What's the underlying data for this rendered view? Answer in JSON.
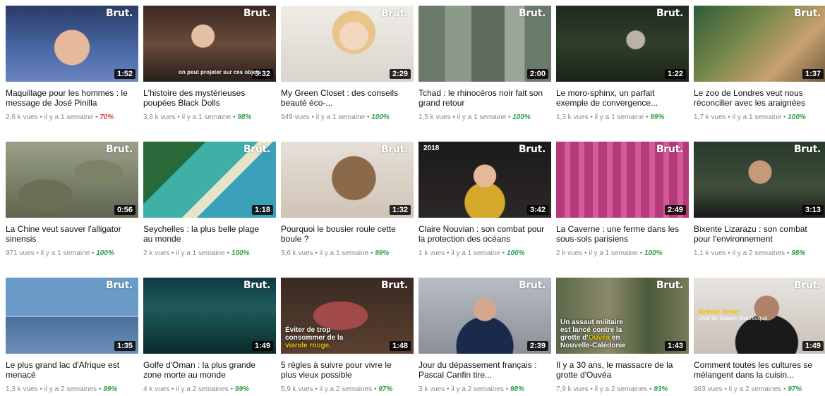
{
  "videos": [
    {
      "title": "Maquillage pour les hommes : le message de José Pinilla",
      "duration": "1:52",
      "views": "2,6 k vues",
      "age": "il y a 1 semaine",
      "rating": "70%",
      "brand": "Brut.",
      "thumb_icon": "man-talking-thumbnail"
    },
    {
      "title": "L'histoire des mystérieuses poupées Black Dolls",
      "duration": "3:32",
      "views": "3,6 k vues",
      "age": "il y a 1 semaine",
      "rating": "98%",
      "brand": "Brut.",
      "thumb_icon": "woman-in-gallery-thumbnail",
      "caption": "on peut projeter sur ces objets"
    },
    {
      "title": "My Green Closet : des conseils beauté éco-...",
      "duration": "2:29",
      "views": "949 vues",
      "age": "il y a 1 semaine",
      "rating": "100%",
      "brand": "Brut.",
      "thumb_icon": "blonde-woman-thumbnail"
    },
    {
      "title": "Tchad : le rhinocéros noir fait son grand retour",
      "duration": "2:00",
      "views": "1,5 k vues",
      "age": "il y a 1 semaine",
      "rating": "100%",
      "brand": "Brut.",
      "thumb_icon": "rhino-in-enclosure-thumbnail"
    },
    {
      "title": "Le moro-sphinx, un parfait exemple de convergence...",
      "duration": "1:22",
      "views": "1,3 k vues",
      "age": "il y a 1 semaine",
      "rating": "99%",
      "brand": "Brut.",
      "thumb_icon": "hawk-moth-thumbnail"
    },
    {
      "title": "Le zoo de Londres veut nous réconcilier avec les araignées",
      "duration": "1:37",
      "views": "1,7 k vues",
      "age": "il y a 1 semaine",
      "rating": "100%",
      "brand": "Brut.",
      "thumb_icon": "woman-with-spider-thumbnail"
    },
    {
      "title": "La Chine veut sauver l'alligator sinensis",
      "duration": "0:56",
      "views": "971 vues",
      "age": "il y a 1 semaine",
      "rating": "100%",
      "brand": "Brut.",
      "thumb_icon": "alligators-thumbnail"
    },
    {
      "title": "Seychelles : la plus belle plage au monde",
      "duration": "1:18",
      "views": "2 k vues",
      "age": "il y a 1 semaine",
      "rating": "100%",
      "brand": "Brut.",
      "thumb_icon": "beach-aerial-thumbnail"
    },
    {
      "title": "Pourquoi le bousier roule cette boule ?",
      "duration": "1:32",
      "views": "3,6 k vues",
      "age": "il y a 1 semaine",
      "rating": "99%",
      "brand": "Brut.",
      "thumb_icon": "dung-beetle-thumbnail"
    },
    {
      "title": "Claire Nouvian : son combat pour la protection des océans",
      "duration": "3:42",
      "views": "1 k vues",
      "age": "il y a 1 semaine",
      "rating": "100%",
      "brand": "Brut.",
      "thumb_icon": "woman-interview-thumbnail",
      "year": "2018"
    },
    {
      "title": "La Caverne : une ferme dans les sous-sols parisiens",
      "duration": "2:49",
      "views": "2 k vues",
      "age": "il y a 1 semaine",
      "rating": "100%",
      "brand": "Brut.",
      "thumb_icon": "underground-farm-thumbnail"
    },
    {
      "title": "Bixente Lizarazu : son combat pour l'environnement",
      "duration": "3:13",
      "views": "1,1 k vues",
      "age": "il y a 2 semaines",
      "rating": "98%",
      "brand": "Brut.",
      "thumb_icon": "man-interview-thumbnail"
    },
    {
      "title": "Le plus grand lac d'Afrique est menacé",
      "duration": "1:35",
      "views": "1,3 k vues",
      "age": "il y a 2 semaines",
      "rating": "99%",
      "brand": "Brut.",
      "thumb_icon": "lake-thumbnail"
    },
    {
      "title": "Golfe d'Oman : la plus grande zone morte au monde",
      "duration": "1:49",
      "views": "4 k vues",
      "age": "il y a 2 semaines",
      "rating": "99%",
      "brand": "Brut.",
      "thumb_icon": "seabed-thumbnail"
    },
    {
      "title": "5 règles à suivre pour vivre le plus vieux possible",
      "duration": "1:48",
      "views": "5,9 k vues",
      "age": "il y a 2 semaines",
      "rating": "97%",
      "brand": "Brut.",
      "thumb_icon": "meat-cutting-thumbnail",
      "overlay_prefix": "Éviter de trop consommer de la ",
      "overlay_highlight": "viande rouge."
    },
    {
      "title": "Jour du dépassement français : Pascal Canfin tire...",
      "duration": "2:39",
      "views": "3 k vues",
      "age": "il y a 2 semaines",
      "rating": "98%",
      "brand": "Brut.",
      "thumb_icon": "man-in-suit-thumbnail"
    },
    {
      "title": "Il y a 30 ans, le massacre de la grotte d'Ouvéa",
      "duration": "1:43",
      "views": "7,9 k vues",
      "age": "il y a 2 semaines",
      "rating": "93%",
      "brand": "Brut.",
      "thumb_icon": "soldiers-thumbnail",
      "overlay_prefix": "Un assaut militaire est lancé contre la grotte d'",
      "overlay_highlight": "Ouvéa",
      "overlay_suffix": " en Nouvelle-Calédonie"
    },
    {
      "title": "Comment toutes les cultures se mélangent dans la cuisin...",
      "duration": "1:49",
      "views": "963 vues",
      "age": "il y a 2 semaines",
      "rating": "97%",
      "brand": "Brut.",
      "thumb_icon": "chef-thumbnail",
      "name_tag": "Meksut Aekur",
      "name_sub": "Chef de Maison Mauresque"
    }
  ],
  "meta_separator": "•",
  "colors": {
    "rating_good": "#2aa34a",
    "rating_low": "#e0463c",
    "meta": "#888888"
  }
}
